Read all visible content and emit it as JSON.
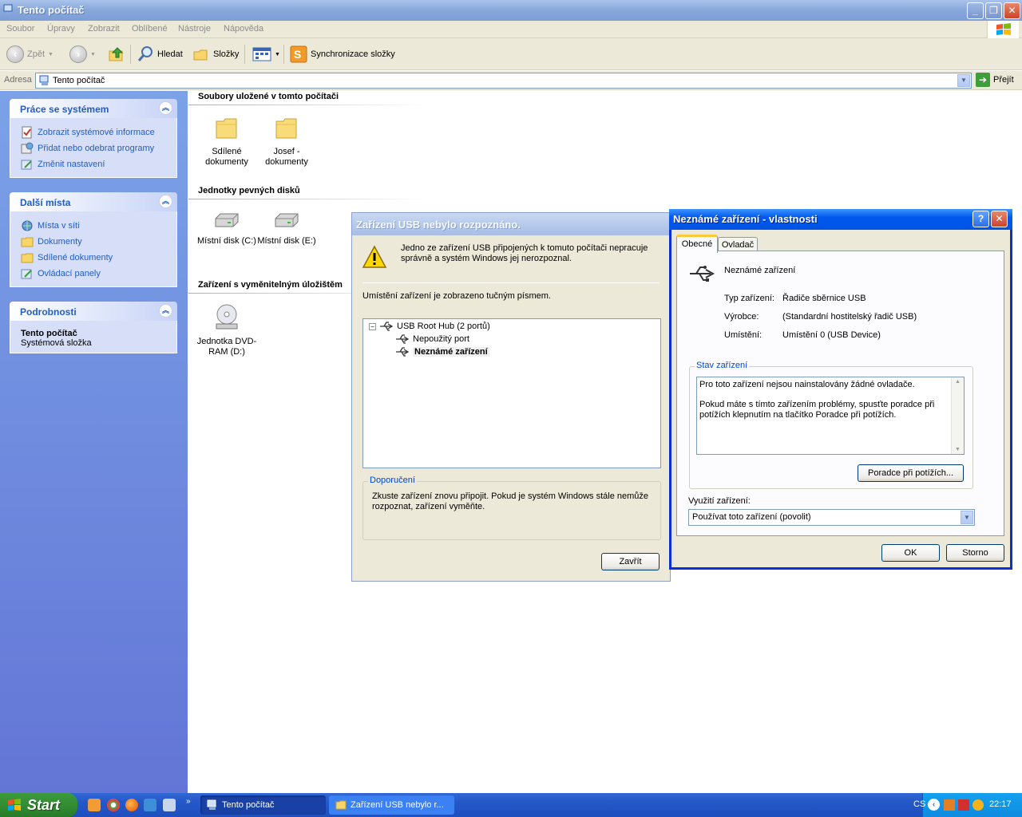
{
  "window": {
    "title": "Tento počítač"
  },
  "menu": [
    "Soubor",
    "Úpravy",
    "Zobrazit",
    "Oblíbené",
    "Nástroje",
    "Nápověda"
  ],
  "toolbar": {
    "back": "Zpět",
    "search": "Hledat",
    "folders": "Složky",
    "sync": "Synchronizace složky"
  },
  "address": {
    "label": "Adresa",
    "value": "Tento počítač",
    "go": "Přejít"
  },
  "leftpane": {
    "system_tasks": {
      "title": "Práce se systémem",
      "items": [
        "Zobrazit systémové informace",
        "Přidat nebo odebrat programy",
        "Změnit nastavení"
      ]
    },
    "other_places": {
      "title": "Další místa",
      "items": [
        "Místa v síti",
        "Dokumenty",
        "Sdílené dokumenty",
        "Ovládací panely"
      ]
    },
    "details": {
      "title": "Podrobnosti",
      "name": "Tento počítač",
      "type": "Systémová složka"
    }
  },
  "main": {
    "groups": [
      {
        "title": "Soubory uložené v tomto počítači",
        "items": [
          "Sdílené dokumenty",
          "Josef - dokumenty"
        ]
      },
      {
        "title": "Jednotky pevných disků",
        "items": [
          "Místní disk (C:)",
          "Místní disk (E:)"
        ]
      },
      {
        "title": "Zařízení s vyměnitelným úložištěm",
        "items": [
          "Jednotka DVD-RAM (D:)"
        ]
      }
    ]
  },
  "usb_dialog": {
    "title": "Zařízení USB nebylo rozpoznáno.",
    "message": "Jedno ze zařízení USB připojených k tomuto počítači nepracuje správně a systém Windows jej nerozpoznal.",
    "location_note": "Umístění zařízení je zobrazeno tučným písmem.",
    "tree": [
      "USB Root Hub (2 portů)",
      "Nepoužitý port",
      "Neznámé zařízení"
    ],
    "recommendation_legend": "Doporučení",
    "recommendation": "Zkuste zařízení znovu připojit. Pokud je systém Windows stále nemůže rozpoznat, zařízení vyměňte.",
    "close": "Zavřít"
  },
  "props_dialog": {
    "title": "Neznámé zařízení - vlastnosti",
    "tabs": [
      "Obecné",
      "Ovladač"
    ],
    "device_name": "Neznámé zařízení",
    "fields": [
      {
        "label": "Typ zařízení:",
        "value": "Řadiče sběrnice USB"
      },
      {
        "label": "Výrobce:",
        "value": "(Standardní hostitelský řadič USB)"
      },
      {
        "label": "Umístění:",
        "value": "Umístění 0 (USB Device)"
      }
    ],
    "status_legend": "Stav zařízení",
    "status_line1": "Pro toto zařízení nejsou nainstalovány žádné ovladače.",
    "status_line2": "Pokud máte s tímto zařízením problémy, spusťte poradce při potížích klepnutím na tlačítko Poradce při potížích.",
    "troubleshoot": "Poradce při potížích...",
    "usage_label": "Využití zařízení:",
    "usage_value": "Používat toto zařízení (povolit)",
    "ok": "OK",
    "cancel": "Storno"
  },
  "taskbar": {
    "start": "Start",
    "tasks": [
      "Tento počítač",
      "Zařízení USB nebylo r..."
    ],
    "lang": "CS",
    "clock": "22:17"
  }
}
